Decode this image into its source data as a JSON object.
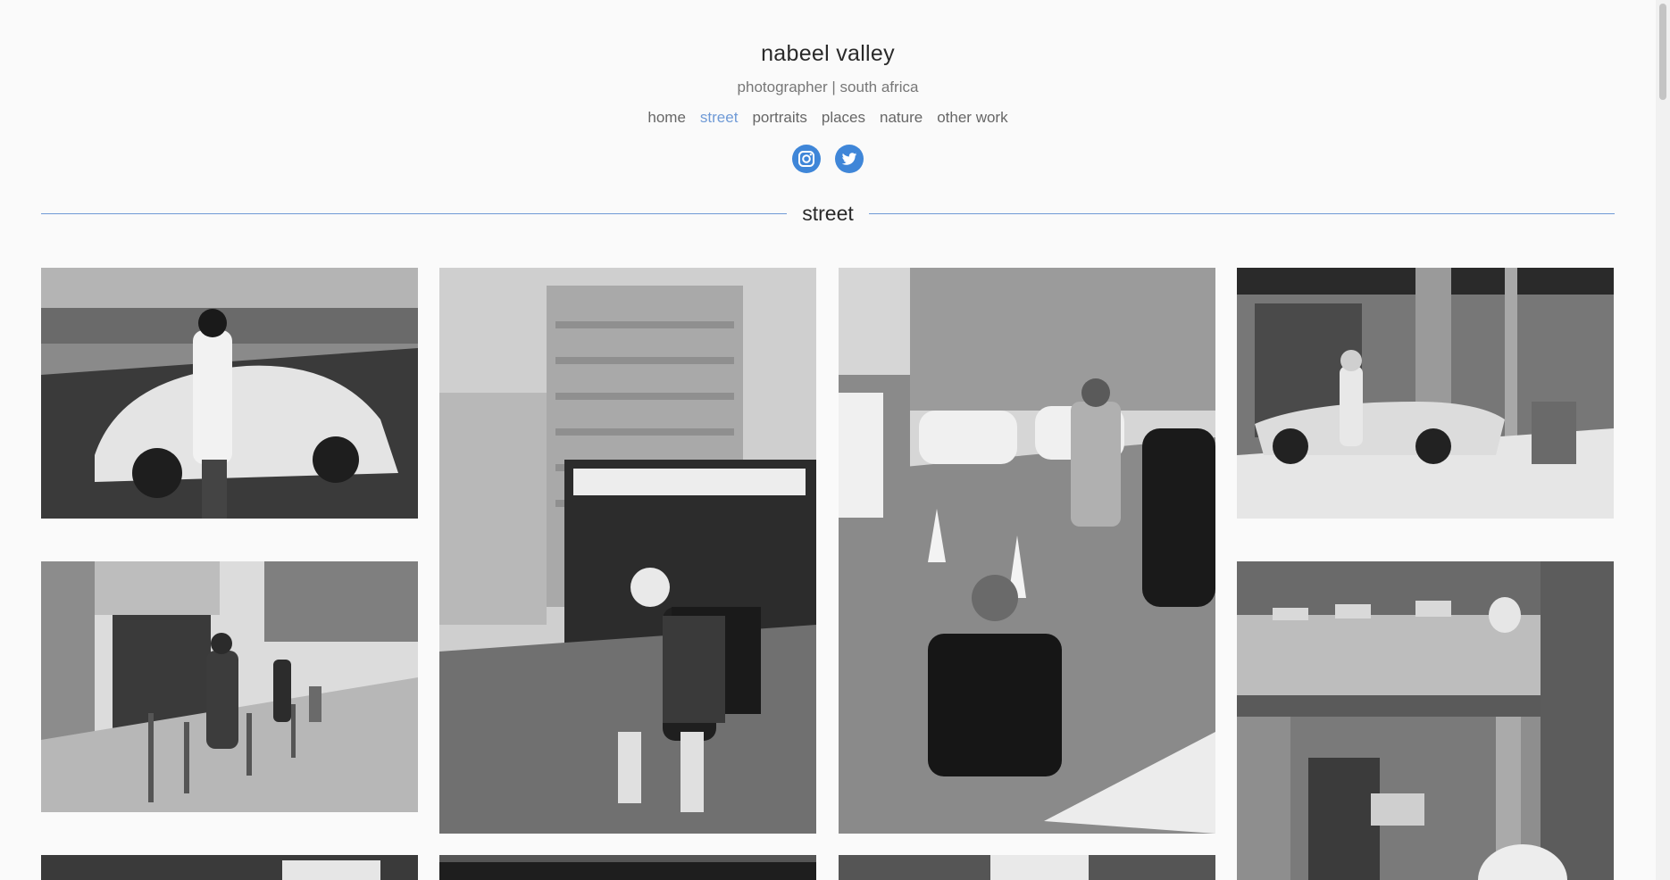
{
  "site": {
    "title": "nabeel valley",
    "tagline": "photographer | south africa"
  },
  "nav": {
    "items": [
      "home",
      "street",
      "portraits",
      "places",
      "nature",
      "other work"
    ],
    "active": "street"
  },
  "social": {
    "instagram_icon": "instagram-icon",
    "twitter_icon": "twitter-icon",
    "color": "#3f86d8"
  },
  "section": {
    "title": "street"
  },
  "theme": {
    "accent": "#6f9ad6",
    "background": "#fafafa"
  }
}
